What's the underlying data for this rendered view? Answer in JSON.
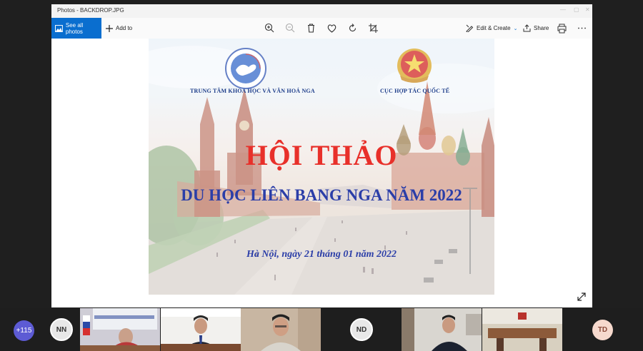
{
  "window": {
    "title": "Photos - BACKDROP.JPG",
    "toolbar": {
      "see_all_label": "See all photos",
      "add_to_label": "Add to",
      "edit_create_label": "Edit & Create",
      "share_label": "Share"
    }
  },
  "slide": {
    "left_org": "TRUNG TÂM KHOA HỌC VÀ VĂN HOÁ NGA",
    "right_org": "CỤC HỢP TÁC QUỐC TẾ",
    "heading": "HỘI THẢO",
    "subheading": "DU HỌC LIÊN BANG NGA NĂM 2022",
    "dateline": "Hà Nội, ngày 21 tháng 01 năm 2022"
  },
  "participants": {
    "more_count": "+115",
    "initials": [
      "NN",
      "ND",
      "TD"
    ]
  }
}
